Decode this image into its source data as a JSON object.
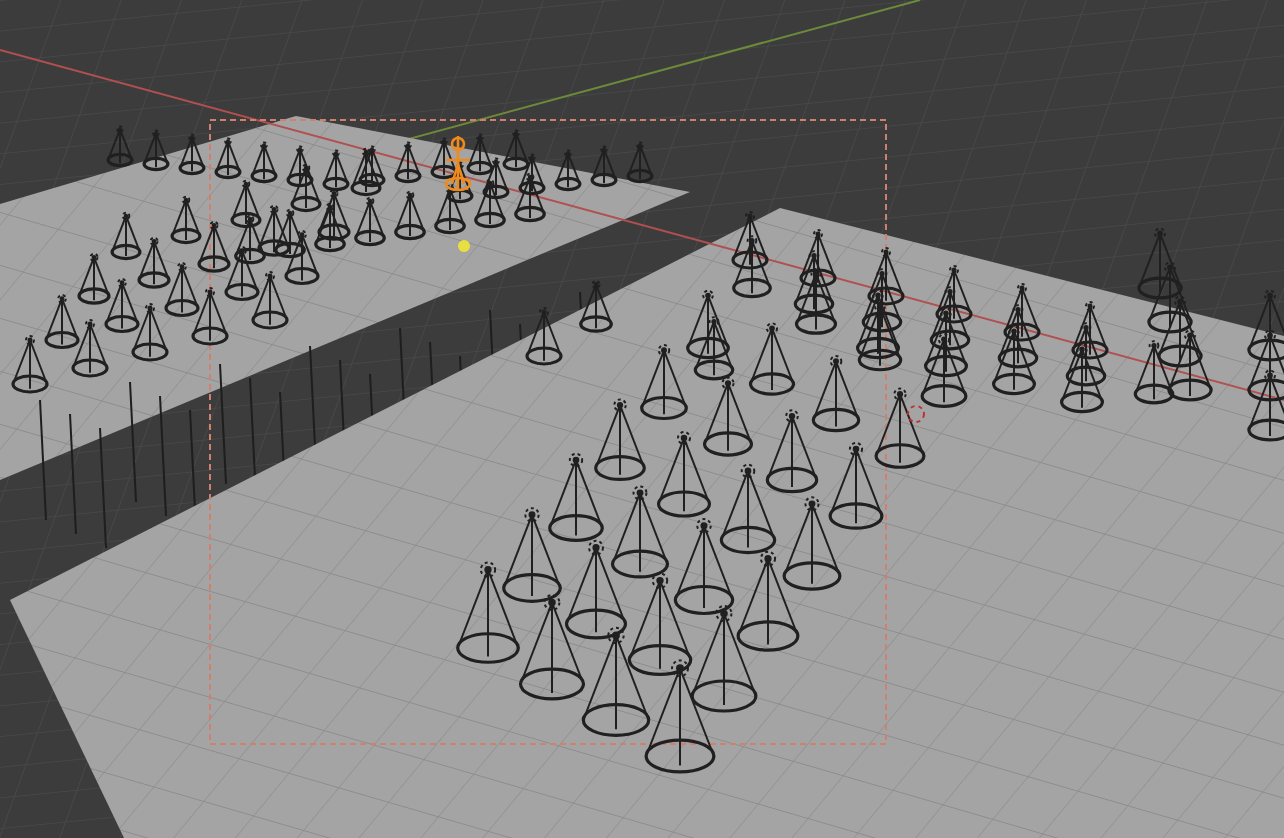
{
  "viewport": {
    "armature": {
      "selected": true
    }
  }
}
